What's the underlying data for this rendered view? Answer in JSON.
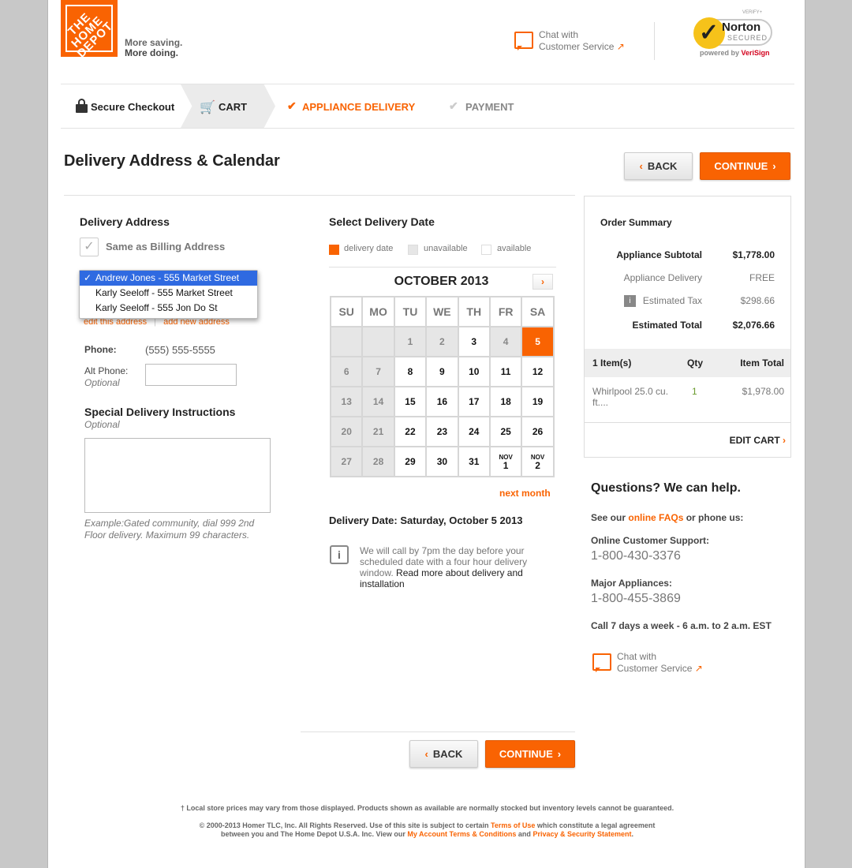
{
  "header": {
    "logo_text": "THE HOME DEPOT",
    "tagline_1": "More saving.",
    "tagline_2": "More doing.",
    "chat_line1": "Chat with",
    "chat_line2": "Customer Service",
    "chat_arrow": "↗",
    "norton_verify": "VERIFY+",
    "norton_name": "Norton",
    "norton_secured": "SECURED",
    "powered_by": "powered by",
    "verisign": "VeriSign"
  },
  "steps": {
    "secure_checkout": "Secure Checkout",
    "cart": "CART",
    "appliance_delivery": "APPLIANCE DELIVERY",
    "payment": "PAYMENT"
  },
  "title": "Delivery Address & Calendar",
  "buttons": {
    "back": "BACK",
    "continue": "CONTINUE"
  },
  "delivery_address": {
    "heading": "Delivery Address",
    "same_as_billing": "Same as Billing Address",
    "options": [
      "Andrew Jones - 555 Market Street",
      "Karly Seeloff - 555 Market Street",
      "Karly Seeloff - 555 Jon Do St"
    ],
    "selected_index": 0,
    "edit_link": "edit this address",
    "add_link": "add new address",
    "phone_label": "Phone:",
    "phone_value": "(555) 555-5555",
    "alt_phone_label": "Alt Phone:",
    "alt_phone_optional": "Optional",
    "alt_phone_value": ""
  },
  "special_instructions": {
    "heading": "Special Delivery Instructions",
    "optional": "Optional",
    "value": "",
    "hint": "Example:Gated community, dial 999 2nd Floor delivery. Maximum 99 characters."
  },
  "calendar": {
    "heading": "Select Delivery Date",
    "legend": {
      "delivery": "delivery date",
      "unavailable": "unavailable",
      "available": "available"
    },
    "legend_colors": {
      "delivery": "#f96302",
      "unavailable": "#e6e6e6",
      "available": "#ffffff"
    },
    "month_title": "OCTOBER 2013",
    "next_arrow": "›",
    "days": [
      "SU",
      "MO",
      "TU",
      "WE",
      "TH",
      "FR",
      "SA"
    ],
    "weeks": [
      [
        {
          "d": "",
          "s": "un"
        },
        {
          "d": "",
          "s": "un"
        },
        {
          "d": "1",
          "s": "un"
        },
        {
          "d": "2",
          "s": "un"
        },
        {
          "d": "3",
          "s": "av"
        },
        {
          "d": "4",
          "s": "un"
        },
        {
          "d": "5",
          "s": "sel"
        }
      ],
      [
        {
          "d": "6",
          "s": "un"
        },
        {
          "d": "7",
          "s": "un"
        },
        {
          "d": "8",
          "s": "av"
        },
        {
          "d": "9",
          "s": "av"
        },
        {
          "d": "10",
          "s": "av"
        },
        {
          "d": "11",
          "s": "av"
        },
        {
          "d": "12",
          "s": "av"
        }
      ],
      [
        {
          "d": "13",
          "s": "un"
        },
        {
          "d": "14",
          "s": "un"
        },
        {
          "d": "15",
          "s": "av"
        },
        {
          "d": "16",
          "s": "av"
        },
        {
          "d": "17",
          "s": "av"
        },
        {
          "d": "18",
          "s": "av"
        },
        {
          "d": "19",
          "s": "av"
        }
      ],
      [
        {
          "d": "20",
          "s": "un"
        },
        {
          "d": "21",
          "s": "un"
        },
        {
          "d": "22",
          "s": "av"
        },
        {
          "d": "23",
          "s": "av"
        },
        {
          "d": "24",
          "s": "av"
        },
        {
          "d": "25",
          "s": "av"
        },
        {
          "d": "26",
          "s": "av"
        }
      ],
      [
        {
          "d": "27",
          "s": "un"
        },
        {
          "d": "28",
          "s": "un"
        },
        {
          "d": "29",
          "s": "av"
        },
        {
          "d": "30",
          "s": "av"
        },
        {
          "d": "31",
          "s": "av"
        },
        {
          "d": "1",
          "m": "NOV",
          "s": "av"
        },
        {
          "d": "2",
          "m": "NOV",
          "s": "av"
        }
      ]
    ],
    "next_month": "next month",
    "delivery_date_text": "Delivery Date: Saturday, October 5 2013",
    "info_text": "We will call by 7pm the day before your scheduled date with a four hour delivery window.",
    "info_link": "Read more about delivery and installation"
  },
  "order_summary": {
    "heading": "Order Summary",
    "subtotal_label": "Appliance Subtotal",
    "subtotal_value": "$1,778.00",
    "delivery_label": "Appliance Delivery",
    "delivery_value": "FREE",
    "tax_label": "Estimated Tax",
    "tax_value": "$298.66",
    "total_label": "Estimated Total",
    "total_value": "$2,076.66",
    "items_header": "1  Item(s)",
    "qty_header": "Qty",
    "item_total_header": "Item Total",
    "item_name": "Whirlpool 25.0 cu. ft....",
    "item_qty": "1",
    "item_total": "$1,978.00",
    "edit_cart": "EDIT CART"
  },
  "help": {
    "heading": "Questions? We can help.",
    "see_our": "See our",
    "faqs": "online FAQs",
    "or_phone": "or phone us:",
    "online_label": "Online Customer Support:",
    "online_phone": "1-800-430-3376",
    "major_label": "Major Appliances:",
    "major_phone": "1-800-455-3869",
    "hours": "Call 7 days a week - 6 a.m. to 2 a.m. EST",
    "chat_line1": "Chat with",
    "chat_line2": "Customer Service"
  },
  "footer": {
    "line1": "† Local store prices may vary from those displayed. Products shown as available are normally stocked but inventory levels cannot be guaranteed.",
    "line2a": "© 2000-2013 Homer TLC, Inc. All Rights Reserved. Use of this site is subject to certain",
    "terms": "Terms of Use",
    "line2b": "which constitute a legal agreement",
    "line3a": "between you and The Home Depot U.S.A. Inc. View our",
    "my_account": "My Account Terms & Conditions",
    "and": "and",
    "privacy": "Privacy & Security Statement",
    "period": "."
  }
}
